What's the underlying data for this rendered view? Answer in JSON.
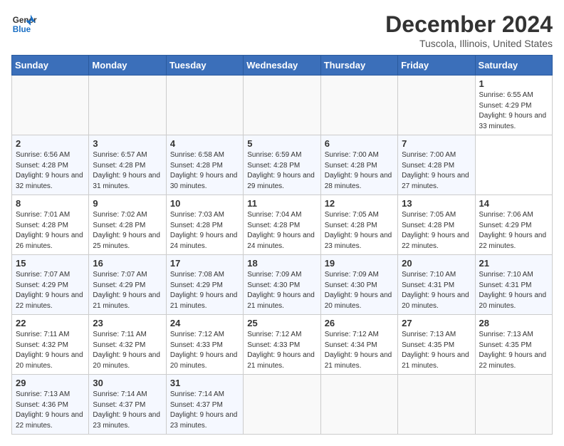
{
  "header": {
    "logo_line1": "General",
    "logo_line2": "Blue",
    "title": "December 2024",
    "subtitle": "Tuscola, Illinois, United States"
  },
  "calendar": {
    "days_of_week": [
      "Sunday",
      "Monday",
      "Tuesday",
      "Wednesday",
      "Thursday",
      "Friday",
      "Saturday"
    ],
    "weeks": [
      [
        null,
        null,
        null,
        null,
        null,
        null,
        {
          "day": 1,
          "sunrise": "6:55 AM",
          "sunset": "4:29 PM",
          "daylight": "9 hours and 33 minutes."
        }
      ],
      [
        {
          "day": 2,
          "sunrise": "6:56 AM",
          "sunset": "4:28 PM",
          "daylight": "9 hours and 32 minutes."
        },
        {
          "day": 3,
          "sunrise": "6:57 AM",
          "sunset": "4:28 PM",
          "daylight": "9 hours and 31 minutes."
        },
        {
          "day": 4,
          "sunrise": "6:58 AM",
          "sunset": "4:28 PM",
          "daylight": "9 hours and 30 minutes."
        },
        {
          "day": 5,
          "sunrise": "6:59 AM",
          "sunset": "4:28 PM",
          "daylight": "9 hours and 29 minutes."
        },
        {
          "day": 6,
          "sunrise": "7:00 AM",
          "sunset": "4:28 PM",
          "daylight": "9 hours and 28 minutes."
        },
        {
          "day": 7,
          "sunrise": "7:00 AM",
          "sunset": "4:28 PM",
          "daylight": "9 hours and 27 minutes."
        }
      ],
      [
        {
          "day": 8,
          "sunrise": "7:01 AM",
          "sunset": "4:28 PM",
          "daylight": "9 hours and 26 minutes."
        },
        {
          "day": 9,
          "sunrise": "7:02 AM",
          "sunset": "4:28 PM",
          "daylight": "9 hours and 25 minutes."
        },
        {
          "day": 10,
          "sunrise": "7:03 AM",
          "sunset": "4:28 PM",
          "daylight": "9 hours and 24 minutes."
        },
        {
          "day": 11,
          "sunrise": "7:04 AM",
          "sunset": "4:28 PM",
          "daylight": "9 hours and 24 minutes."
        },
        {
          "day": 12,
          "sunrise": "7:05 AM",
          "sunset": "4:28 PM",
          "daylight": "9 hours and 23 minutes."
        },
        {
          "day": 13,
          "sunrise": "7:05 AM",
          "sunset": "4:28 PM",
          "daylight": "9 hours and 22 minutes."
        },
        {
          "day": 14,
          "sunrise": "7:06 AM",
          "sunset": "4:29 PM",
          "daylight": "9 hours and 22 minutes."
        }
      ],
      [
        {
          "day": 15,
          "sunrise": "7:07 AM",
          "sunset": "4:29 PM",
          "daylight": "9 hours and 22 minutes."
        },
        {
          "day": 16,
          "sunrise": "7:07 AM",
          "sunset": "4:29 PM",
          "daylight": "9 hours and 21 minutes."
        },
        {
          "day": 17,
          "sunrise": "7:08 AM",
          "sunset": "4:29 PM",
          "daylight": "9 hours and 21 minutes."
        },
        {
          "day": 18,
          "sunrise": "7:09 AM",
          "sunset": "4:30 PM",
          "daylight": "9 hours and 21 minutes."
        },
        {
          "day": 19,
          "sunrise": "7:09 AM",
          "sunset": "4:30 PM",
          "daylight": "9 hours and 20 minutes."
        },
        {
          "day": 20,
          "sunrise": "7:10 AM",
          "sunset": "4:31 PM",
          "daylight": "9 hours and 20 minutes."
        },
        {
          "day": 21,
          "sunrise": "7:10 AM",
          "sunset": "4:31 PM",
          "daylight": "9 hours and 20 minutes."
        }
      ],
      [
        {
          "day": 22,
          "sunrise": "7:11 AM",
          "sunset": "4:32 PM",
          "daylight": "9 hours and 20 minutes."
        },
        {
          "day": 23,
          "sunrise": "7:11 AM",
          "sunset": "4:32 PM",
          "daylight": "9 hours and 20 minutes."
        },
        {
          "day": 24,
          "sunrise": "7:12 AM",
          "sunset": "4:33 PM",
          "daylight": "9 hours and 20 minutes."
        },
        {
          "day": 25,
          "sunrise": "7:12 AM",
          "sunset": "4:33 PM",
          "daylight": "9 hours and 21 minutes."
        },
        {
          "day": 26,
          "sunrise": "7:12 AM",
          "sunset": "4:34 PM",
          "daylight": "9 hours and 21 minutes."
        },
        {
          "day": 27,
          "sunrise": "7:13 AM",
          "sunset": "4:35 PM",
          "daylight": "9 hours and 21 minutes."
        },
        {
          "day": 28,
          "sunrise": "7:13 AM",
          "sunset": "4:35 PM",
          "daylight": "9 hours and 22 minutes."
        }
      ],
      [
        {
          "day": 29,
          "sunrise": "7:13 AM",
          "sunset": "4:36 PM",
          "daylight": "9 hours and 22 minutes."
        },
        {
          "day": 30,
          "sunrise": "7:14 AM",
          "sunset": "4:37 PM",
          "daylight": "9 hours and 23 minutes."
        },
        {
          "day": 31,
          "sunrise": "7:14 AM",
          "sunset": "4:37 PM",
          "daylight": "9 hours and 23 minutes."
        },
        null,
        null,
        null,
        null
      ]
    ]
  }
}
